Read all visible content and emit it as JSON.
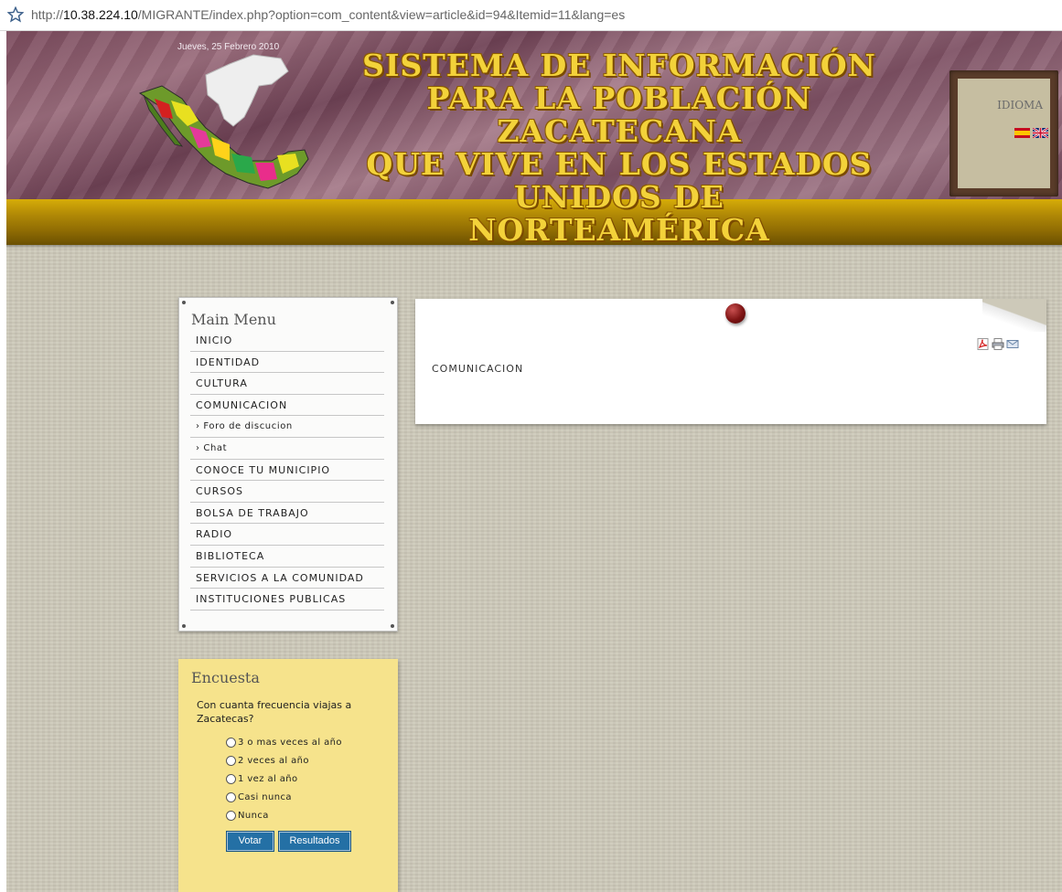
{
  "browser": {
    "url_host_prefix": "http://",
    "url_host": "10.38.224.10",
    "url_path": "/MIGRANTE/index.php?option=com_content&view=article&id=94&Itemid=11&lang=es"
  },
  "header": {
    "date": "Jueves, 25 Febrero 2010",
    "title_line1": "SISTEMA DE INFORMACIÓN",
    "title_line2": "PARA LA POBLACIÓN ZACATECANA",
    "title_line3": "QUE VIVE EN LOS ESTADOS UNIDOS DE",
    "title_line4": "NORTEAMÉRICA",
    "language_label": "IDIOMA"
  },
  "main_menu": {
    "title": "Main Menu",
    "items": [
      {
        "label": "INICIO",
        "sub": false
      },
      {
        "label": "IDENTIDAD",
        "sub": false
      },
      {
        "label": "CULTURA",
        "sub": false
      },
      {
        "label": "COMUNICACION",
        "sub": false
      },
      {
        "label": "› Foro de discucion",
        "sub": true
      },
      {
        "label": "› Chat",
        "sub": true
      },
      {
        "label": "CONOCE TU MUNICIPIO",
        "sub": false
      },
      {
        "label": "CURSOS",
        "sub": false
      },
      {
        "label": "BOLSA DE TRABAJO",
        "sub": false
      },
      {
        "label": "RADIO",
        "sub": false
      },
      {
        "label": "BIBLIOTECA",
        "sub": false
      },
      {
        "label": "SERVICIOS A LA COMUNIDAD",
        "sub": false
      },
      {
        "label": "INSTITUCIONES PUBLICAS",
        "sub": false
      }
    ]
  },
  "poll": {
    "title": "Encuesta",
    "question": "Con cuanta frecuencia viajas a Zacatecas?",
    "options": [
      "3 o mas veces al año",
      "2 veces al año",
      "1 vez al año",
      "Casi nunca",
      "Nunca"
    ],
    "vote_label": "Votar",
    "results_label": "Resultados"
  },
  "article": {
    "text": "COMUNICACION",
    "icons": [
      "pdf-icon",
      "print-icon",
      "email-icon"
    ]
  },
  "colors": {
    "gold": "#d6ac08",
    "banner": "#7a4a5c",
    "poll_bg": "#f6e38c",
    "button": "#2470a5"
  }
}
